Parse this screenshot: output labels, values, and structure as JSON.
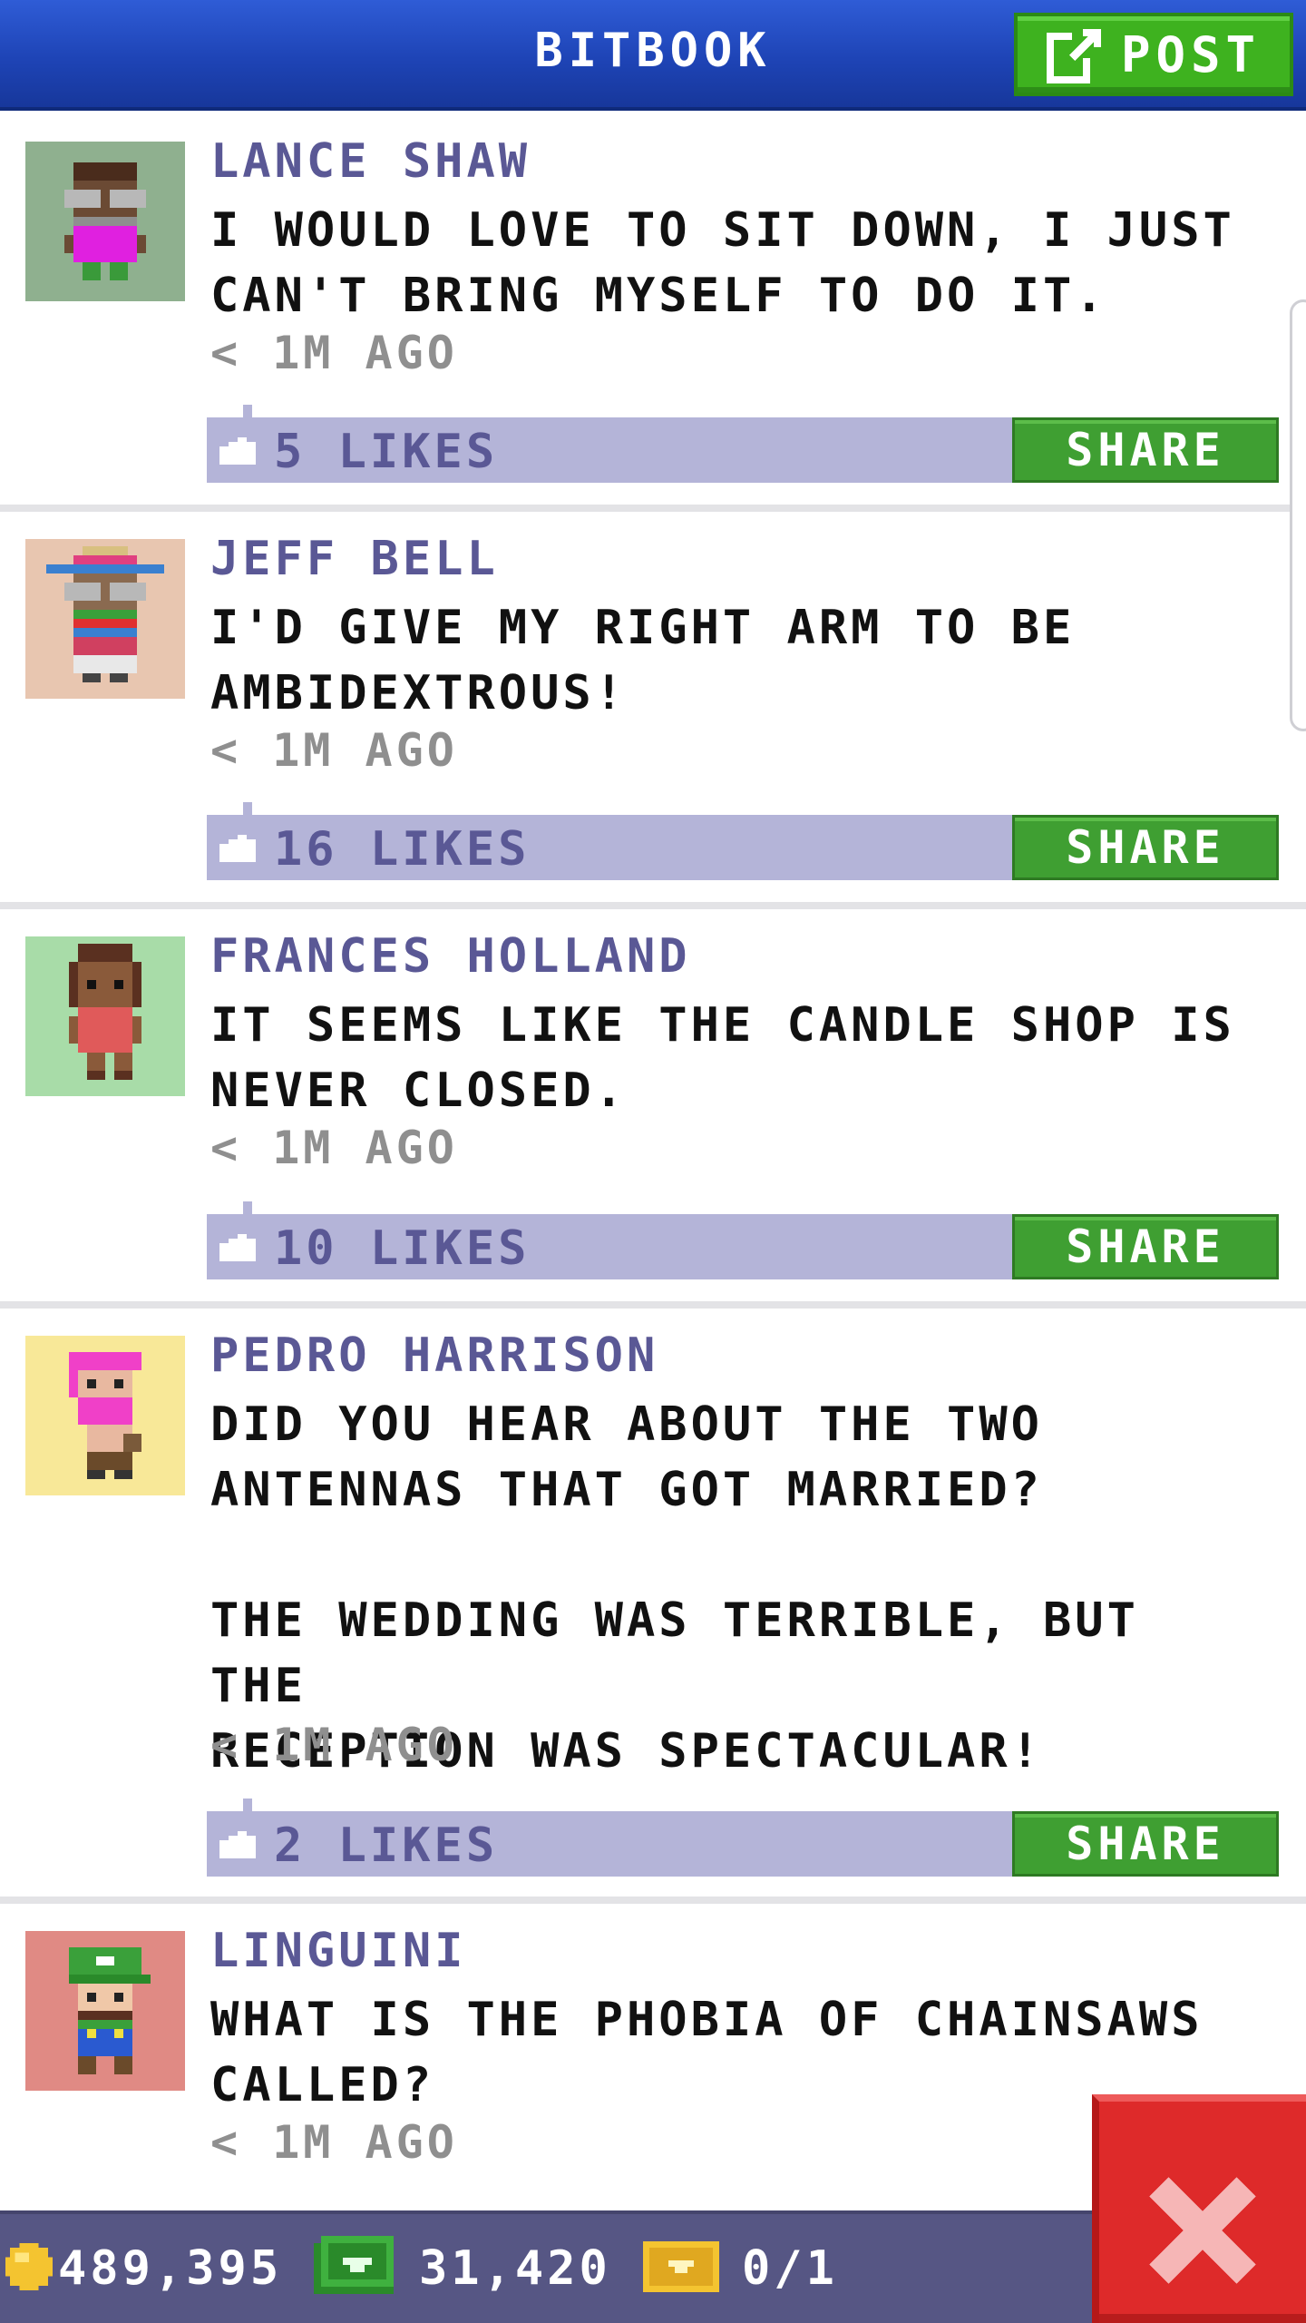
{
  "header": {
    "title": "BITBOOK",
    "post_label": "POST"
  },
  "posts": [
    {
      "author": "LANCE SHAW",
      "text": "I WOULD LOVE TO SIT DOWN, I JUST\nCAN'T BRING MYSELF TO DO IT.",
      "time": "< 1M AGO",
      "likes": "5 LIKES",
      "share": "SHARE"
    },
    {
      "author": "JEFF BELL",
      "text": "I'D GIVE MY RIGHT ARM TO BE\nAMBIDEXTROUS!",
      "time": "< 1M AGO",
      "likes": "16 LIKES",
      "share": "SHARE"
    },
    {
      "author": "FRANCES HOLLAND",
      "text": "IT SEEMS LIKE THE CANDLE SHOP IS\nNEVER CLOSED.",
      "time": "< 1M AGO",
      "likes": "10 LIKES",
      "share": "SHARE"
    },
    {
      "author": "PEDRO HARRISON",
      "text": "DID YOU HEAR ABOUT THE TWO\nANTENNAS THAT GOT MARRIED?\n\nTHE WEDDING WAS TERRIBLE, BUT THE\nRECEPTION WAS SPECTACULAR!",
      "time": "< 1M AGO",
      "likes": "2 LIKES",
      "share": "SHARE"
    },
    {
      "author": "LINGUINI",
      "text": "WHAT IS THE PHOBIA OF CHAINSAWS\nCALLED?",
      "time": "< 1M AGO"
    }
  ],
  "bottom_bar": {
    "coins": "489,395",
    "bux": "31,420",
    "vip": "0/1"
  },
  "icons": {
    "post": "edit-icon",
    "like": "thumbs-up-icon",
    "coin": "coin-icon",
    "bux": "cash-icon",
    "vip": "ticket-icon",
    "close": "close-icon"
  },
  "colors": {
    "header": "#1e44b6",
    "share": "#3f9f32",
    "likes_bar": "#b4b4d8",
    "author": "#5a5895",
    "close": "#de2a2a"
  }
}
